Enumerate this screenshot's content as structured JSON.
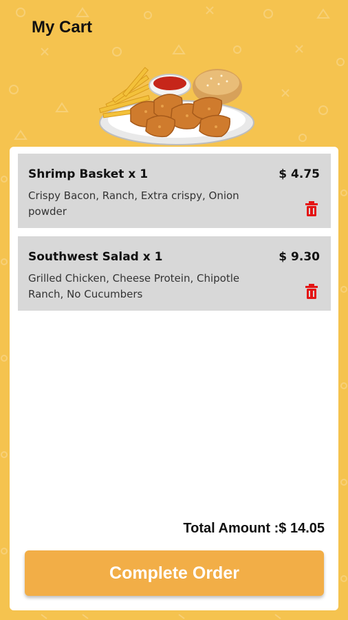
{
  "header": {
    "title": "My Cart"
  },
  "cart": {
    "items": [
      {
        "name": "Shrimp Basket x 1",
        "price": "$ 4.75",
        "description": "Crispy Bacon, Ranch, Extra crispy, Onion powder"
      },
      {
        "name": "Southwest Salad x 1",
        "price": "$ 9.30",
        "description": "Grilled Chicken, Cheese Protein, Chipotle Ranch, No Cucumbers"
      }
    ],
    "total_label": "Total Amount :$ 14.05",
    "complete_button_label": "Complete Order"
  },
  "colors": {
    "background": "#f5c34f",
    "button": "#f2ae47",
    "item_background": "#d8d8d8",
    "delete_icon": "#e41414"
  },
  "icons": {
    "delete": "trash-icon"
  }
}
